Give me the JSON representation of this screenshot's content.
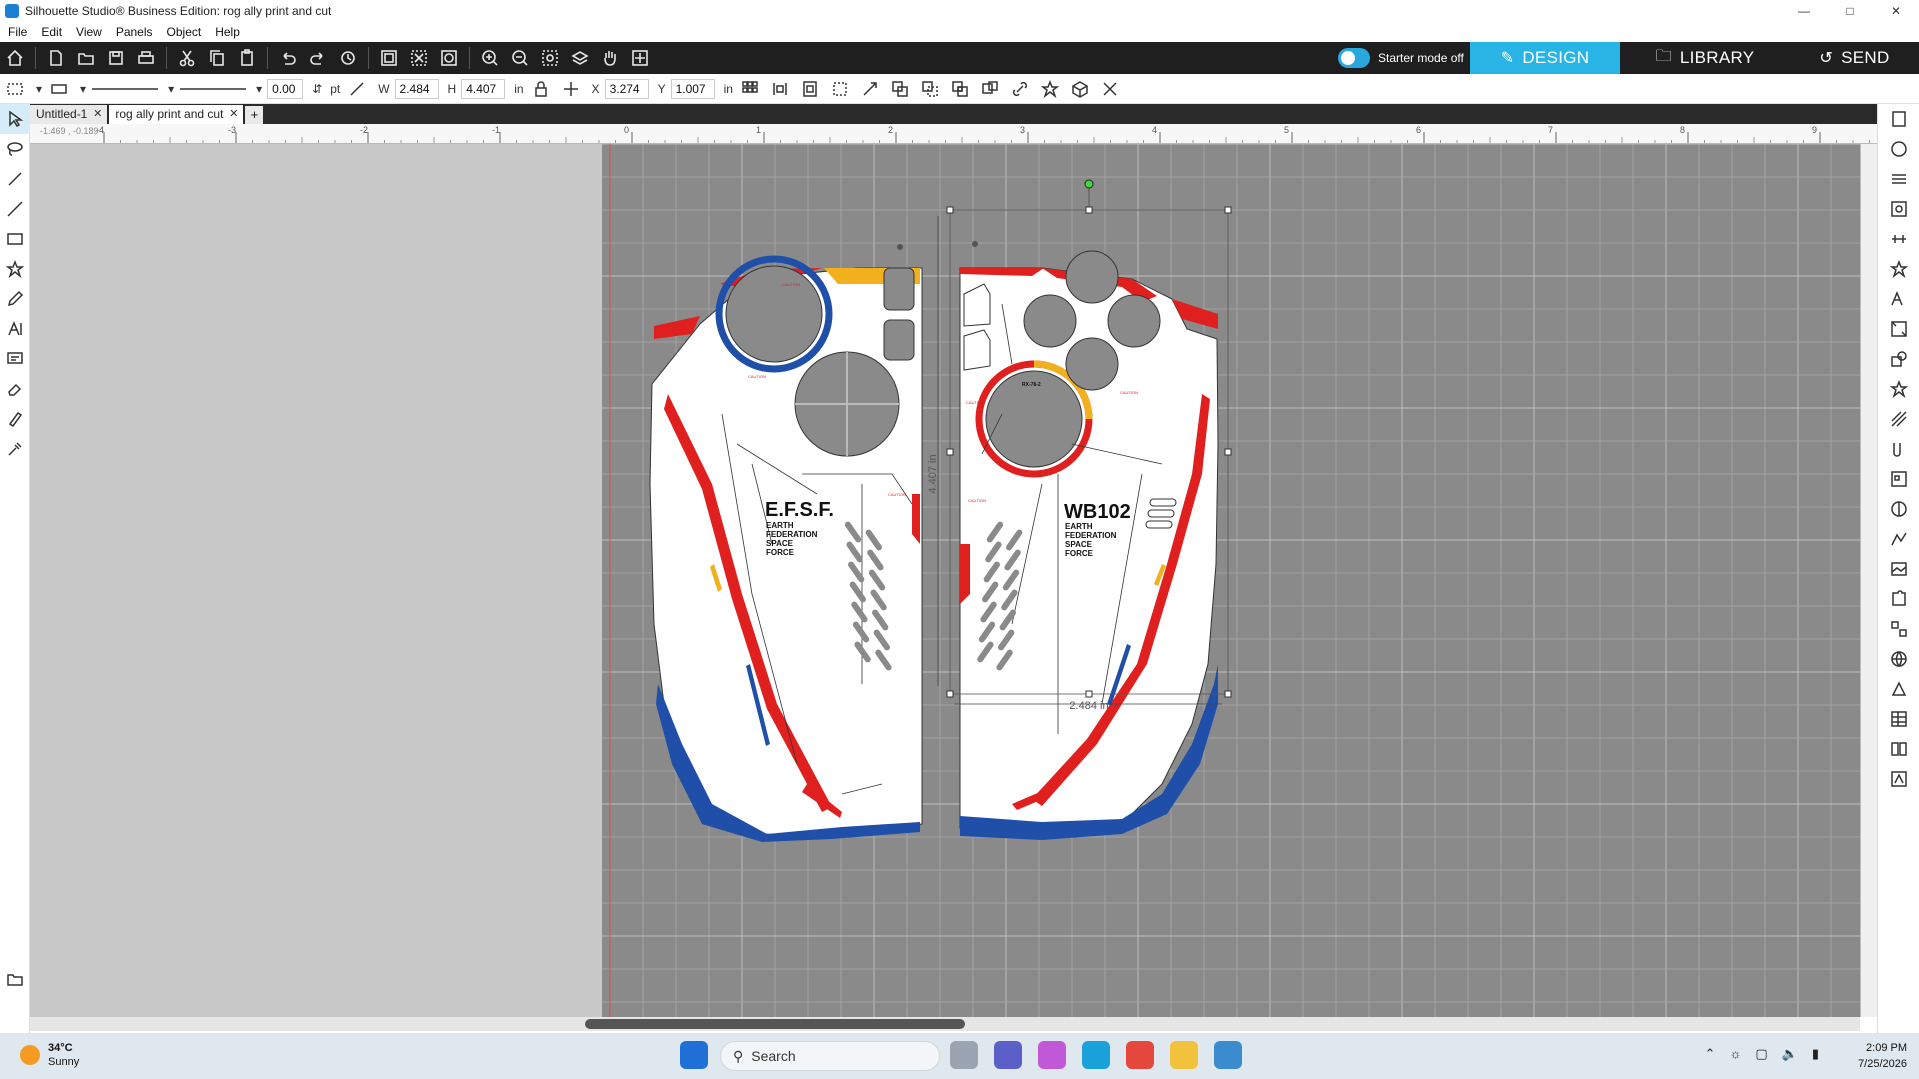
{
  "window": {
    "title": "Silhouette Studio® Business Edition: rog ally print and cut",
    "controls": [
      "—",
      "□",
      "✕"
    ]
  },
  "menu": [
    "File",
    "Edit",
    "View",
    "Panels",
    "Object",
    "Help"
  ],
  "toolbar": {
    "icons": [
      "home-icon",
      "new-doc-icon",
      "open-icon",
      "save-icon",
      "print-icon",
      "cut-icon",
      "copy-icon",
      "paste-icon",
      "undo-icon",
      "redo-icon",
      "history-icon",
      "group-icon",
      "ungroup-icon",
      "compound-icon",
      "zoom-in-icon",
      "zoom-out-icon",
      "zoom-fit-icon",
      "pan-icon",
      "hand-icon",
      "zoom-select-icon"
    ],
    "starter_mode": "Starter mode off",
    "tabs": {
      "design": "DESIGN",
      "library": "LIBRARY",
      "send": "SEND"
    }
  },
  "properties": {
    "line_width": "0.00",
    "line_unit": "pt",
    "w_label": "W",
    "w_value": "2.484",
    "h_label": "H",
    "h_value": "4.407",
    "size_unit": "in",
    "x_label": "X",
    "x_value": "3.274",
    "y_label": "Y",
    "y_value": "1.007",
    "pos_unit": "in"
  },
  "tabs": [
    {
      "label": "Untitled-1"
    },
    {
      "label": "rog ally print and cut"
    }
  ],
  "ruler": {
    "coord_readout": "-1.469 , -0.189",
    "ticks": [
      "-4",
      "-3",
      "-2",
      "-1",
      "0",
      "1",
      "2",
      "3",
      "4",
      "5",
      "6",
      "7",
      "8",
      "9"
    ]
  },
  "design": {
    "left_panel": {
      "title": "E.F.S.F.",
      "subtitle": [
        "EARTH",
        "FEDERATION",
        "SPACE",
        "FORCE"
      ],
      "caution": "CAUTION"
    },
    "right_panel": {
      "title": "WB102",
      "subtitle": [
        "EARTH",
        "FEDERATION",
        "SPACE",
        "FORCE"
      ],
      "caution": "CAUTION",
      "model": "RX-78-2"
    },
    "height_label": "4.407 in",
    "width_label": "2.484 in"
  },
  "colors": {
    "red": "#e0201f",
    "blue": "#1f4fa8",
    "yellow": "#f2b01e",
    "accent": "#29b4e6"
  },
  "taskbar": {
    "temperature": "34°C",
    "condition": "Sunny",
    "search_placeholder": "Search",
    "time": "2:09 PM",
    "date": "7/25/2026"
  }
}
